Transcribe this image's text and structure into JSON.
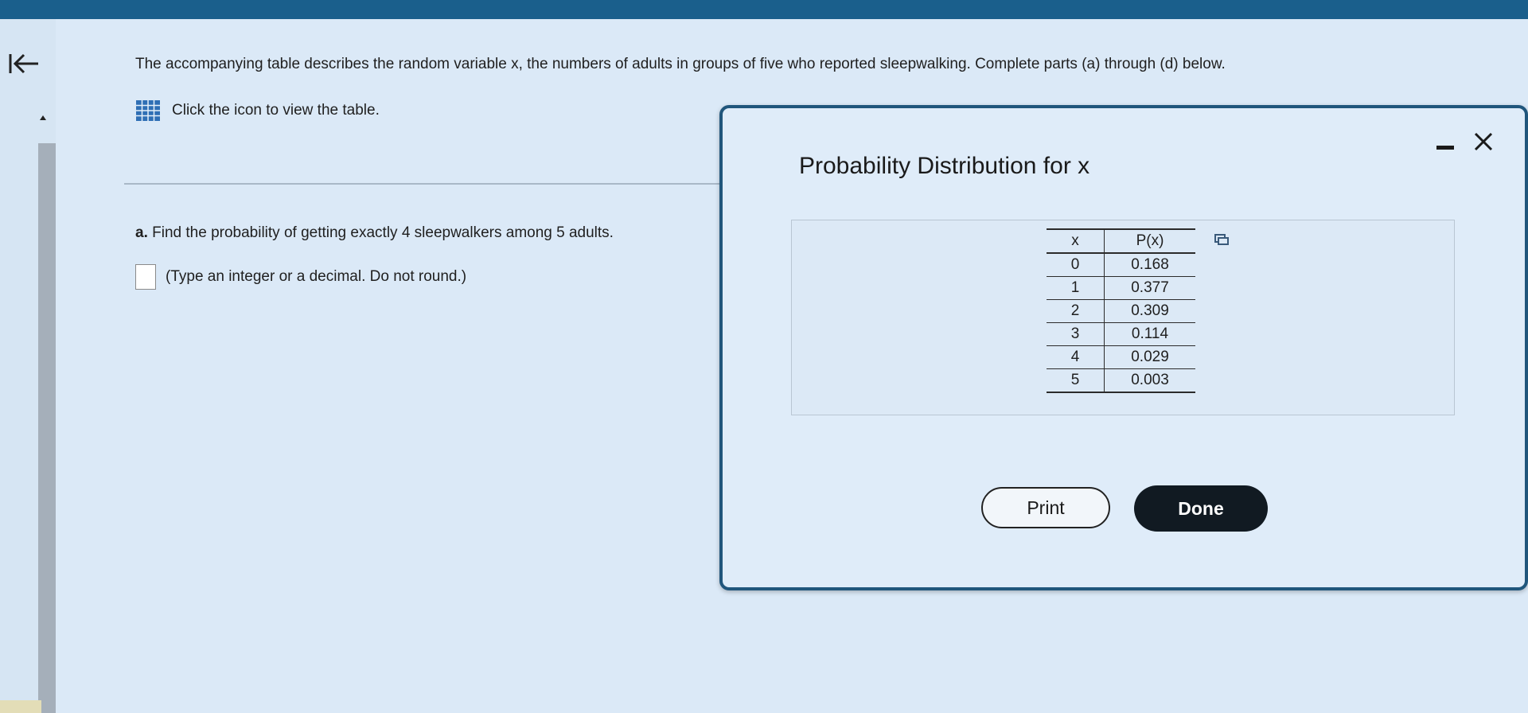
{
  "question": {
    "text": "The accompanying table describes the random variable x, the numbers of adults in groups of five who reported sleepwalking. Complete parts (a) through (d) below.",
    "table_link_text": "Click the icon to view the table."
  },
  "part_a": {
    "label": "a.",
    "text": "Find the probability of getting exactly 4 sleepwalkers among 5 adults.",
    "answer_value": "",
    "hint": "(Type an integer or a decimal. Do not round.)"
  },
  "modal": {
    "title": "Probability Distribution for x",
    "table": {
      "headers": [
        "x",
        "P(x)"
      ],
      "rows": [
        [
          "0",
          "0.168"
        ],
        [
          "1",
          "0.377"
        ],
        [
          "2",
          "0.309"
        ],
        [
          "3",
          "0.114"
        ],
        [
          "4",
          "0.029"
        ],
        [
          "5",
          "0.003"
        ]
      ]
    },
    "print_label": "Print",
    "done_label": "Done"
  },
  "colors": {
    "top_bar": "#1a5f8c",
    "background": "#dbe9f7",
    "modal_border": "#20567c",
    "done_button": "#111a22",
    "table_icon": "#2f6fb5"
  },
  "icons": [
    "back-icon",
    "table-icon",
    "minimize-icon",
    "close-icon",
    "copy-icon"
  ]
}
